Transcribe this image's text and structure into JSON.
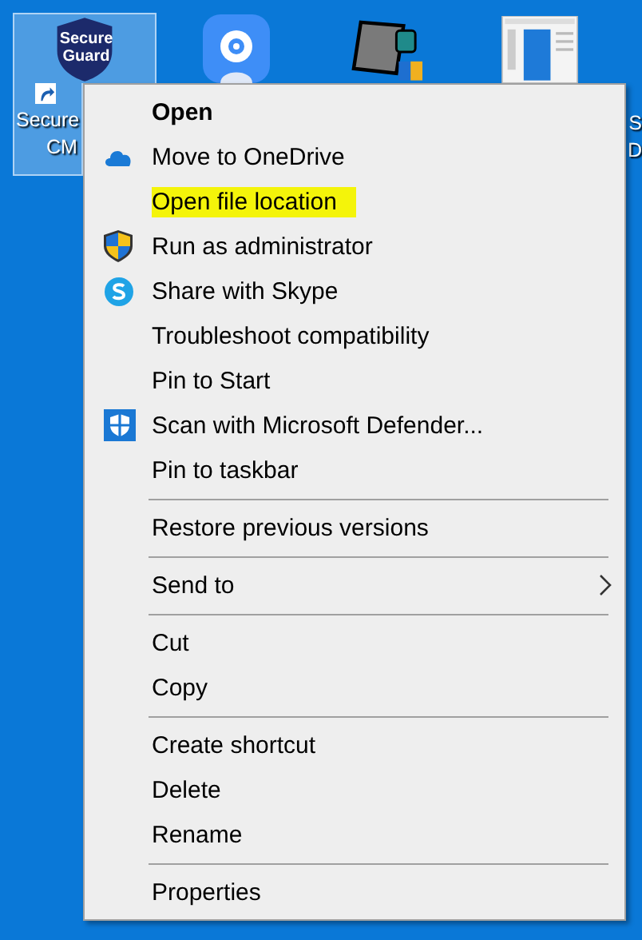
{
  "desktop": {
    "icons": [
      {
        "badge": "Secure Guard",
        "lines": [
          "Secure",
          "CM"
        ],
        "selected": true
      },
      {
        "selected": false
      },
      {
        "selected": false
      },
      {
        "lines": [
          "S",
          "D"
        ],
        "selected": false
      }
    ]
  },
  "context_menu": {
    "items": [
      {
        "kind": "default",
        "label": "Open"
      },
      {
        "kind": "item",
        "label": "Move to OneDrive"
      },
      {
        "kind": "item",
        "label": "Open file location",
        "highlighted": true
      },
      {
        "kind": "item",
        "label": "Run as administrator"
      },
      {
        "kind": "item",
        "label": "Share with Skype"
      },
      {
        "kind": "item",
        "label": "Troubleshoot compatibility"
      },
      {
        "kind": "item",
        "label": "Pin to Start"
      },
      {
        "kind": "item",
        "label": "Scan with Microsoft Defender..."
      },
      {
        "kind": "item",
        "label": "Pin to taskbar"
      },
      {
        "kind": "separator"
      },
      {
        "kind": "item",
        "label": "Restore previous versions"
      },
      {
        "kind": "separator"
      },
      {
        "kind": "submenu",
        "label": "Send to"
      },
      {
        "kind": "separator"
      },
      {
        "kind": "item",
        "label": "Cut"
      },
      {
        "kind": "item",
        "label": "Copy"
      },
      {
        "kind": "separator"
      },
      {
        "kind": "item",
        "label": "Create shortcut"
      },
      {
        "kind": "item",
        "label": "Delete"
      },
      {
        "kind": "item",
        "label": "Rename"
      },
      {
        "kind": "separator"
      },
      {
        "kind": "item",
        "label": "Properties"
      }
    ]
  }
}
